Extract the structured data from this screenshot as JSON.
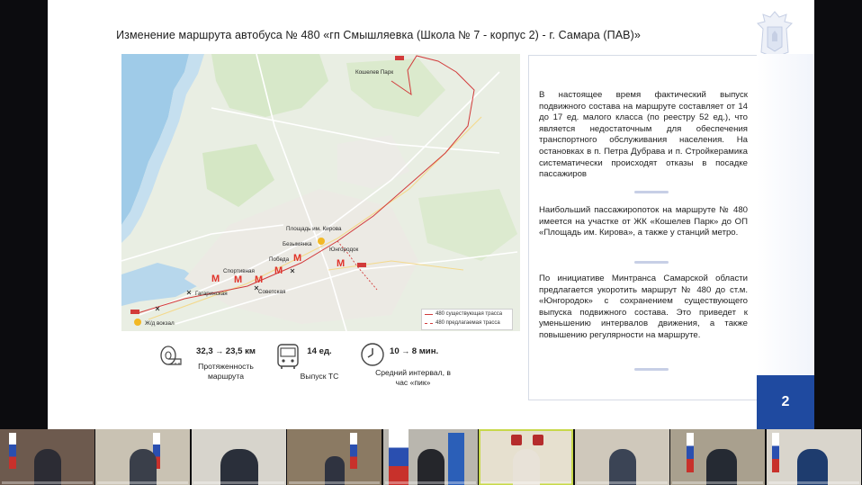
{
  "slide": {
    "title": "Изменение маршрута автобуса № 480 «гп Смышляевка (Школа № 7 - корпус 2) - г. Самара (ПАВ)»",
    "page_number": "2"
  },
  "map": {
    "labels": {
      "koshelev": "Кошелев Парк",
      "kirova": "Площадь им. Кирова",
      "bezymyanka": "Безымянка",
      "yugorodok": "Юнгородок",
      "pobeda": "Победа",
      "sportivnaya": "Спортивная",
      "gagarinskaya": "Гагаринская",
      "sovetskaya": "Советская",
      "vokzal": "Ж/д вокзал"
    },
    "metro_symbol": "M",
    "legend": {
      "existing": "480 существующая трасса",
      "proposed": "480 предлагаемая трасса"
    },
    "route_color": "#d23b3b"
  },
  "stats": {
    "length": {
      "value_from": "32,3",
      "value_to": "23,5 км",
      "label": "Протяженность маршрута"
    },
    "vehicles": {
      "value": "14 ед.",
      "label": "Выпуск ТС"
    },
    "interval": {
      "value_from": "10",
      "value_to": "8 мин.",
      "label": "Средний интервал, в час «пик»"
    }
  },
  "info": {
    "para1": "В настоящее время фактический выпуск подвижного состава на маршруте составляет от 14 до 17 ед. малого класса (по реестру 52 ед.), что является недостаточным для обеспечения транспортного обслуживания населения. На остановках в п. Петра Дубрава и п. Стройкерамика систематически происходят отказы в посадке пассажиров",
    "para2": "Наибольший пассажиропоток на маршруте № 480 имеется на участке от ЖК «Кошелев Парк» до ОП «Площадь им. Кирова», а также у станций метро.",
    "para3": "По инициативе Минтранса Самарской области предлагается укоротить маршрут № 480 до ст.м. «Юнгородок» с сохранением существующего выпуска подвижного состава. Это приведет к уменьшению интервалов движения, а также повышению регулярности на маршруте."
  },
  "colors": {
    "accent": "#1f4aa0",
    "metro": "#e0332a",
    "stop_marker": "#f2b824"
  }
}
